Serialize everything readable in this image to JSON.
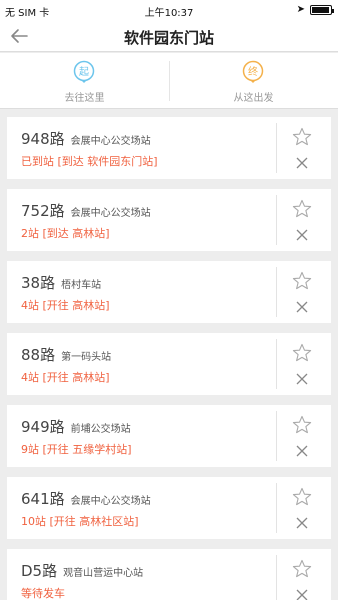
{
  "status_bar": {
    "carrier": "无 SIM 卡",
    "time": "上午10:37"
  },
  "header": {
    "title": "软件园东门站",
    "back_icon": "arrow-left-icon"
  },
  "actions": [
    {
      "label": "去往这里",
      "icon_char": "起",
      "color": "#6cc5ec"
    },
    {
      "label": "从这出发",
      "icon_char": "终",
      "color": "#f4b14b"
    }
  ],
  "routes": [
    {
      "number": "948路",
      "terminal": "会展中心公交场站",
      "status": "已到站 [到达 软件园东门站]"
    },
    {
      "number": "752路",
      "terminal": "会展中心公交场站",
      "status": "2站 [到达 高林站]"
    },
    {
      "number": "38路",
      "terminal": "梧村车站",
      "status": "4站 [开往 高林站]"
    },
    {
      "number": "88路",
      "terminal": "第一码头站",
      "status": "4站 [开往 高林站]"
    },
    {
      "number": "949路",
      "terminal": "前埔公交场站",
      "status": "9站 [开往 五缘学村站]"
    },
    {
      "number": "641路",
      "terminal": "会展中心公交场站",
      "status": "10站 [开往 高林社区站]"
    },
    {
      "number": "D5路",
      "terminal": "观音山营运中心站",
      "status": "等待发车"
    }
  ],
  "colors": {
    "accent_status": "#f0613f",
    "background": "#ededed"
  }
}
